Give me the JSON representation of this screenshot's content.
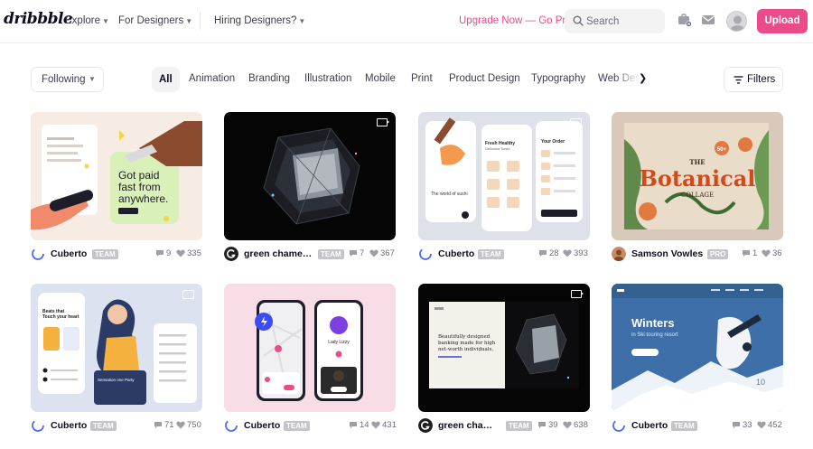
{
  "brand": {
    "logo": "dribbble"
  },
  "nav": {
    "explore": "Explore",
    "designers": "For Designers",
    "hiring": "Hiring Designers?",
    "upgrade": "Upgrade Now — Go Pro",
    "search_placeholder": "Search",
    "upload": "Upload"
  },
  "filters": {
    "following": "Following",
    "filters_label": "Filters",
    "categories": [
      "All",
      "Animation",
      "Branding",
      "Illustration",
      "Mobile",
      "Print",
      "Product Design",
      "Typography",
      "Web Design"
    ]
  },
  "shots": [
    {
      "author": "Cuberto",
      "badge": "TEAM",
      "comments": "9",
      "likes": "335",
      "thumb_text": "Got paid fast from anywhere.",
      "menu_title": "Promo"
    },
    {
      "author": "green chameleon",
      "badge": "TEAM",
      "comments": "7",
      "likes": "367"
    },
    {
      "author": "Cuberto",
      "badge": "TEAM",
      "comments": "28",
      "likes": "393",
      "thumb_title": "Fresh Healthy Delicious Sushi",
      "thumb_sub": "Your Order",
      "thumb_caption": "The world of sushi"
    },
    {
      "author": "Samson Vowles",
      "badge": "PRO",
      "comments": "1",
      "likes": "36",
      "thumb_title": "Botanical",
      "thumb_pre": "THE",
      "thumb_post": "COLLAGE",
      "thumb_num": "50+"
    },
    {
      "author": "Cuberto",
      "badge": "TEAM",
      "comments": "71",
      "likes": "750",
      "thumb_title": "Beats that Touch your heart",
      "thumb_caption": "Sensation one Party"
    },
    {
      "author": "Cuberto",
      "badge": "TEAM",
      "comments": "14",
      "likes": "431",
      "thumb_name": "Lady Lizzy"
    },
    {
      "author": "green chameleon",
      "badge": "TEAM",
      "comments": "39",
      "likes": "638",
      "thumb_title": "Beautifully designed banking made for high net-worth individuals."
    },
    {
      "author": "Cuberto",
      "badge": "TEAM",
      "comments": "33",
      "likes": "452",
      "thumb_title": "Winters",
      "thumb_sub": "in Ski touring resort",
      "thumb_num": "10"
    }
  ],
  "colors": {
    "accent": "#ea4c89",
    "text": "#0d0c22",
    "muted": "#6e6d7a"
  }
}
